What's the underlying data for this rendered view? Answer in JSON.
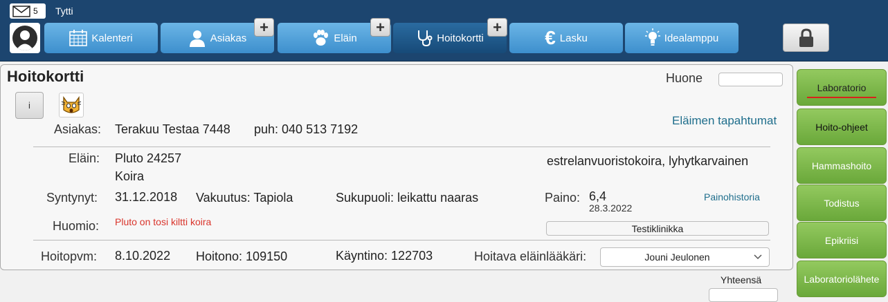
{
  "header": {
    "mail_count": "5",
    "username": "Tytti",
    "tabs": [
      {
        "label": "Kalenteri",
        "icon": "calendar-icon"
      },
      {
        "label": "Asiakas",
        "icon": "person-icon"
      },
      {
        "label": "Eläin",
        "icon": "paw-icon"
      },
      {
        "label": "Hoitokortti",
        "icon": "stethoscope-icon",
        "active": true
      },
      {
        "label": "Lasku",
        "icon": "euro-icon"
      },
      {
        "label": "Idealamppu",
        "icon": "lightbulb-icon"
      }
    ],
    "plus": "+"
  },
  "card": {
    "title": "Hoitokortti",
    "info_button": "i",
    "room_label": "Huone",
    "room_value": "",
    "animal_events_link": "Eläimen tapahtumat",
    "customer_label": "Asiakas:",
    "customer_value": "Terakuu Testaa 7448",
    "phone_text": "puh: 040 513 7192",
    "animal_label": "Eläin:",
    "animal_name": "Pluto 24257",
    "animal_species": "Koira",
    "breed": "estrelanvuoristokoira, lyhytkarvainen",
    "born_label": "Syntynyt:",
    "born_value": "31.12.2018",
    "insurance_text": "Vakuutus: Tapiola",
    "sex_text": "Sukupuoli: leikattu naaras",
    "weight_label": "Paino:",
    "weight_value": "6,4",
    "weight_date": "28.3.2022",
    "weight_history_link": "Painohistoria",
    "note_label": "Huomio:",
    "note_value": "Pluto on tosi kiltti koira",
    "clinic_button": "Testiklinikka",
    "care_date_label": "Hoitopvm:",
    "care_date_value": "8.10.2022",
    "care_no_text": "Hoitono: 109150",
    "visit_no_text": "Käyntino: 122703",
    "vet_label": "Hoitava eläinlääkäri:",
    "vet_value": "Jouni Jeulonen",
    "total_label": "Yhteensä"
  },
  "sidebar": {
    "items": [
      "Laboratorio",
      "Hoito-ohjeet",
      "Hammashoito",
      "Todistus",
      "Epikriisi",
      "Laboratoriolähete"
    ]
  },
  "colors": {
    "topbar": "#1c456f",
    "tab": "#4a9bd6",
    "side_green": "#7db44a",
    "link": "#1f6e8c",
    "note_red": "#d9342b"
  }
}
